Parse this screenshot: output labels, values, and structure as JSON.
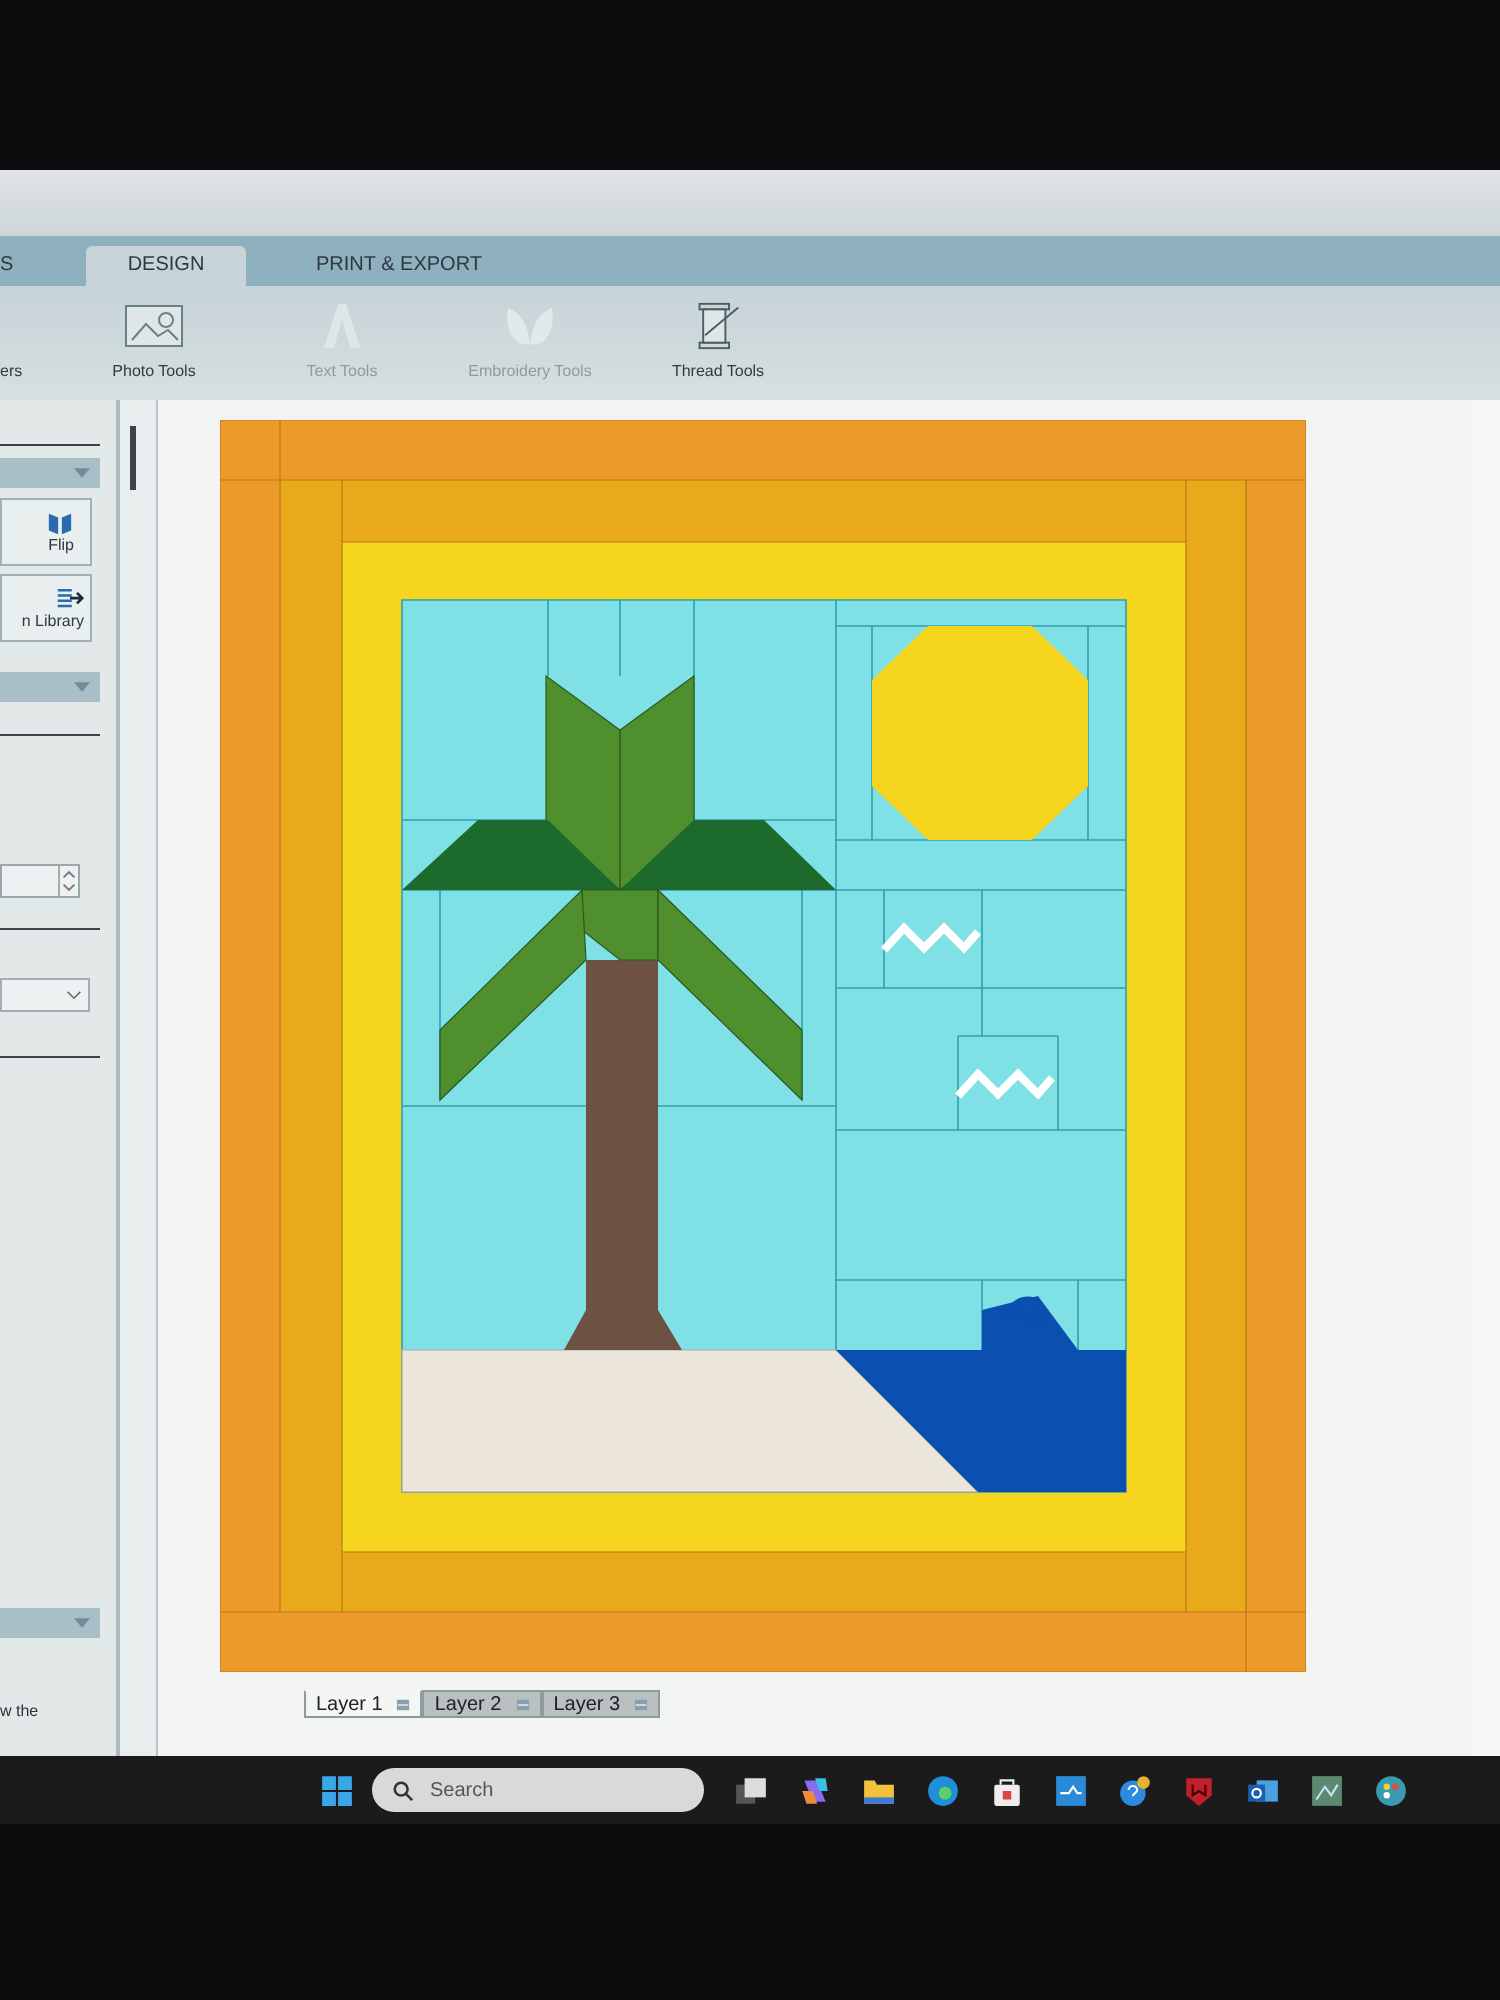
{
  "tabs": [
    {
      "label": "S",
      "selected": false
    },
    {
      "label": "DESIGN",
      "selected": true
    },
    {
      "label": "PRINT & EXPORT",
      "selected": false
    }
  ],
  "toolbar": [
    {
      "label": "ers",
      "kind": "cut",
      "disabled": false
    },
    {
      "label": "Photo Tools",
      "kind": "photo",
      "disabled": false
    },
    {
      "label": "Text Tools",
      "kind": "text",
      "disabled": true
    },
    {
      "label": "Embroidery Tools",
      "kind": "butterfly",
      "disabled": true
    },
    {
      "label": "Thread Tools",
      "kind": "spool",
      "disabled": false
    }
  ],
  "side_panel": {
    "buttons": [
      {
        "label": "Flip",
        "kind": "flip"
      },
      {
        "label": "n Library",
        "kind": "library"
      }
    ],
    "footer_text": "w the"
  },
  "layer_tabs": [
    {
      "label": "Layer 1",
      "selected": true
    },
    {
      "label": "Layer 2",
      "selected": false
    },
    {
      "label": "Layer 3",
      "selected": false
    }
  ],
  "taskbar": {
    "search": {
      "placeholder": "Search"
    }
  }
}
